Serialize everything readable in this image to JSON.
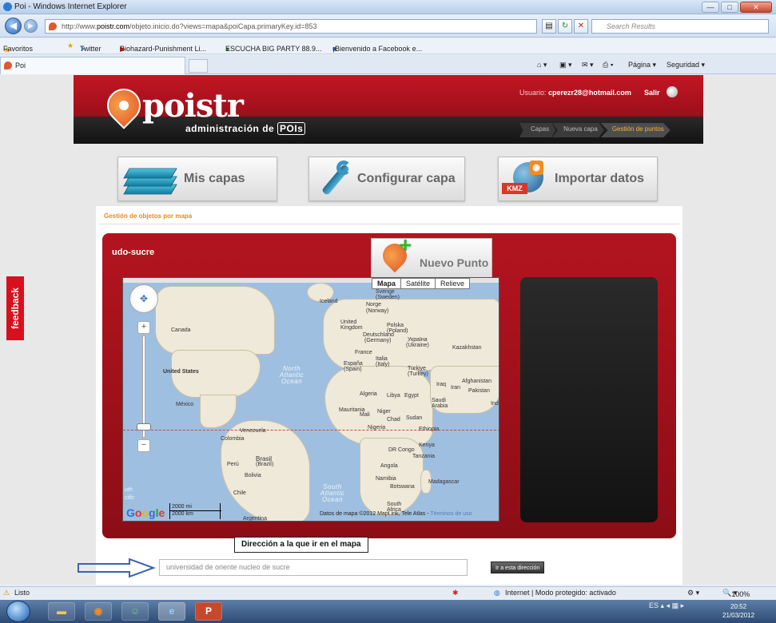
{
  "window": {
    "title": "Poi - Windows Internet Explorer",
    "btn_min": "—",
    "btn_max": "□",
    "btn_close": "✕"
  },
  "address": {
    "url_prefix": "http://www.",
    "url_domain": "poistr.com",
    "url_path": "/objeto.inicio.do?views=mapa&poiCapa.primaryKey.id=853",
    "search_placeholder": "Search Results"
  },
  "favorites": {
    "label": "Favoritos",
    "items": [
      "Twitter",
      "Biohazard-Punishment Li...",
      "ESCUCHA BIG PARTY 88.9...",
      "¡Bienvenido a Facebook e..."
    ]
  },
  "tabs": {
    "active": "Poi",
    "commands": [
      "Página ▾",
      "Seguridad ▾"
    ]
  },
  "site": {
    "logo": "poistr",
    "tagline": "administración de",
    "tagline_badge": "POIs",
    "user_label": "Usuario:",
    "user_email": "cperezr28@hotmail.com",
    "logout": "Salir",
    "breadcrumbs": [
      "Capas",
      "Nueva capa",
      "Gestión de puntos"
    ],
    "buttons": {
      "mis_capas": "Mis capas",
      "configurar": "Configurar capa",
      "importar": "Importar datos",
      "kmz_tag": "KMZ"
    },
    "section_title": "Gestión de objetos por mapa",
    "layer_name": "udo-sucre",
    "new_point": "Nuevo Punto",
    "map": {
      "types": [
        "Mapa",
        "Satélite",
        "Relieve"
      ],
      "selected_type": "Mapa",
      "scale_mi": "2000 mi",
      "scale_km": "2000 km",
      "copyright": "Datos de mapa ©2012 MapLink, Tele Atlas -",
      "terms": "Términos de uso",
      "labels": {
        "canada": "Canada",
        "usa": "United States",
        "mexico": "México",
        "venezuela": "Venezuela",
        "colombia": "Colombia",
        "peru": "Perú",
        "brasil": "Brasil",
        "brasil2": "(Brazil)",
        "bolivia": "Bolivia",
        "chile": "Chile",
        "argentina": "Argentina",
        "iceland": "Iceland",
        "norge": "Norge",
        "norge2": "(Norway)",
        "uk": "United Kingdom",
        "deutschland": "Deutschland",
        "deutschland2": "(Germany)",
        "polska": "Polska",
        "polska2": "(Poland)",
        "ukraine": "Україна",
        "ukraine2": "(Ukraine)",
        "france": "France",
        "espana": "España",
        "espana2": "(Spain)",
        "italia": "Italia",
        "italy": "(Italy)",
        "turkiye": "Türkiye",
        "turkey": "(Turkey)",
        "kazakhstan": "Kazakhstan",
        "algeria": "Algeria",
        "libya": "Libya",
        "egypt": "Egypt",
        "iraq": "Iraq",
        "iran": "Iran",
        "afghanistan": "Afghanistan",
        "pakistan": "Pakistan",
        "saudi": "Saudi Arabia",
        "mauritania": "Mauritania",
        "mali": "Mali",
        "niger": "Niger",
        "chad": "Chad",
        "sudan": "Sudan",
        "nigeria": "Nigeria",
        "ethiopia": "Ethiopia",
        "kenya": "Kenya",
        "drcongo": "DR Congo",
        "tanzania": "Tanzania",
        "angola": "Angola",
        "namibia": "Namibia",
        "botswana": "Botswana",
        "madagascar": "Madagascar",
        "southafrica": "South Africa",
        "ind": "Ind",
        "sverige": "Sverige",
        "sverige2": "(Sweden)",
        "uth": "uth",
        "cific": "cific",
        "north_atlantic": "North Atlantic Ocean",
        "south_atlantic": "South Atlantic Ocean"
      }
    },
    "address_tooltip": "Dirección a la que ir en el mapa",
    "address_value": "universidad de oriente nucleo de sucre",
    "go_button": "Ir a esta dirección",
    "feedback": "feedback"
  },
  "status": {
    "left": "Listo",
    "zone": "Internet | Modo protegido: activado",
    "zoom": "100%"
  },
  "taskbar": {
    "lang": "ES",
    "time": "20:52",
    "date": "21/03/2012"
  }
}
